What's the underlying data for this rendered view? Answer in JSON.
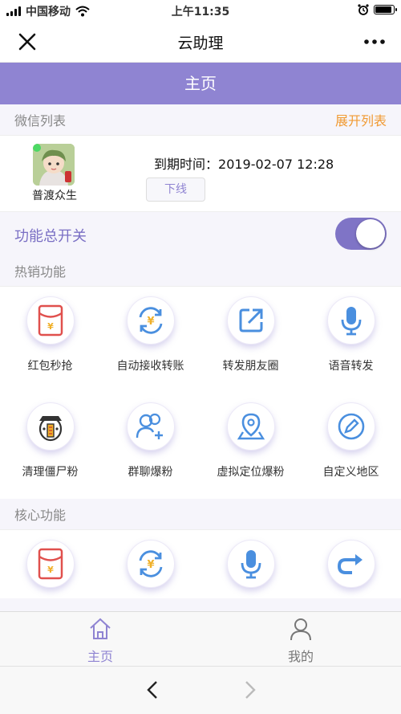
{
  "status": {
    "carrier": "中国移动",
    "time": "上午11:35"
  },
  "nav": {
    "title": "云助理"
  },
  "header": {
    "title": "主页"
  },
  "wechat_list": {
    "title": "微信列表",
    "expand": "展开列表"
  },
  "account": {
    "name": "普渡众生",
    "expire_label": "到期时间：",
    "expire_value": "2019-02-07 12:28",
    "logout": "下线"
  },
  "master_switch": {
    "label": "功能总开关",
    "on": true
  },
  "hot": {
    "title": "热销功能",
    "items": [
      {
        "label": "红包秒抢",
        "icon": "red-envelope-icon"
      },
      {
        "label": "自动接收转账",
        "icon": "auto-transfer-icon"
      },
      {
        "label": "转发朋友圈",
        "icon": "share-moments-icon"
      },
      {
        "label": "语音转发",
        "icon": "microphone-icon"
      },
      {
        "label": "清理僵尸粉",
        "icon": "zombie-cleanup-icon"
      },
      {
        "label": "群聊爆粉",
        "icon": "group-add-icon"
      },
      {
        "label": "虚拟定位爆粉",
        "icon": "location-pin-icon"
      },
      {
        "label": "自定义地区",
        "icon": "edit-region-icon"
      }
    ]
  },
  "core": {
    "title": "核心功能"
  },
  "tabs": [
    {
      "label": "主页",
      "color": "#8f84d2"
    },
    {
      "label": "我的",
      "color": "#777777"
    }
  ],
  "colors": {
    "accent": "#8f84d2",
    "link": "#f19a33",
    "icon_red": "#e0504d",
    "icon_blue": "#4a8fdf",
    "icon_gold": "#f0b02a"
  }
}
